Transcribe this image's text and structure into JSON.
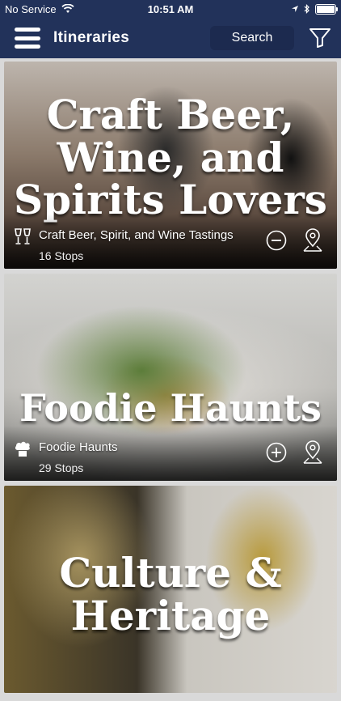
{
  "status": {
    "carrier": "No Service",
    "time": "10:51 AM"
  },
  "navbar": {
    "title": "Itineraries",
    "search_label": "Search"
  },
  "itineraries": [
    {
      "overlay_title": "Craft Beer, Wine, and Spirits Lovers",
      "name": "Craft Beer, Spirit, and Wine Tastings",
      "stops": "16 Stops",
      "icon": "wine-glasses-icon",
      "action": "remove"
    },
    {
      "overlay_title": "Foodie Haunts",
      "name": "Foodie Haunts",
      "stops": "29 Stops",
      "icon": "chef-hat-icon",
      "action": "add"
    },
    {
      "overlay_title": "Culture & Heritage",
      "name": "",
      "stops": "",
      "icon": "",
      "action": ""
    }
  ],
  "colors": {
    "nav": "#22325a",
    "search_bg": "#1c2a4f"
  }
}
